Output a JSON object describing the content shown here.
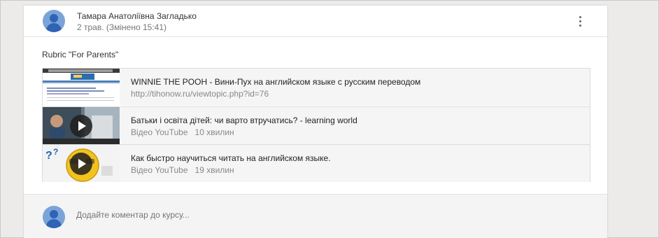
{
  "post": {
    "author": "Тамара Анатоліївна Загладько",
    "date": "2 трав. (Змінено 15:41)",
    "text": "Rubric \"For Parents\""
  },
  "attachments": [
    {
      "title": "WINNIE THE POOH - Вини-Пух на английском языке с русским переводом",
      "subtitle": "http://tihonow.ru/viewtopic.php?id=76",
      "type": "link"
    },
    {
      "title": "Батьки і освіта дітей: чи варто втручатись? - learning world",
      "source": "Відео YouTube",
      "duration": "10 хвилин",
      "type": "video"
    },
    {
      "title": "Как быстро научиться читать на английском языке.",
      "source": "Відео YouTube",
      "duration": "19 хвилин",
      "type": "video"
    }
  ],
  "comment": {
    "placeholder": "Додайте коментар до курсу..."
  },
  "icons": {
    "menu": "more-vert-icon",
    "play": "play-icon",
    "avatar": "avatar-placeholder"
  },
  "colors": {
    "accent_avatar": "#2f63b5",
    "card_background": "#ffffff",
    "page_background": "#ecebe9"
  }
}
